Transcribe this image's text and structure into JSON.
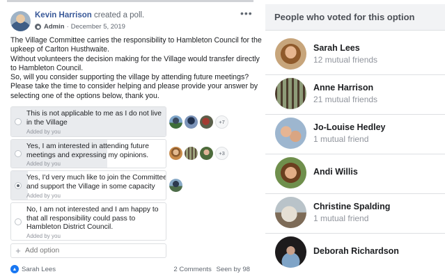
{
  "post": {
    "author": "Kevin Harrison",
    "action": "created a poll.",
    "role": "Admin",
    "date": "December 5, 2019",
    "more": "•••",
    "body_lines": [
      "The Village Committee carries the responsibility to Hambleton Council for the",
      "upkeep of Carlton Husthwaite.",
      "Without volunteers the decision making for the Village would transfer directly",
      "to Hambleton Council.",
      "So, will you consider supporting the village by attending future meetings?",
      "Please take the time to consider helping and please provide your answer by",
      "selecting one of the options below, thank you."
    ],
    "options": [
      {
        "lines": [
          "This is not applicable to me as I do not live",
          "in the Village"
        ],
        "added_by": "Added by you",
        "selected": false,
        "vote_fraction": 1.0,
        "more_voters": "+7"
      },
      {
        "lines": [
          "Yes, I am interested in attending future",
          "meetings and expressing my opinions."
        ],
        "added_by": "Added by you",
        "selected": false,
        "vote_fraction": 0.62,
        "more_voters": "+3"
      },
      {
        "lines": [
          "Yes, I'd very much like to join the Committee",
          "and support the Village in some capacity"
        ],
        "added_by": "Added by you",
        "selected": true,
        "vote_fraction": 0.11,
        "more_voters": ""
      },
      {
        "lines": [
          "No, I am not interested and I am happy to",
          "that all responsibility could pass to",
          "Hambleton District Council."
        ],
        "added_by": "Added by you",
        "selected": false,
        "vote_fraction": 0,
        "more_voters": ""
      }
    ],
    "add_option_placeholder": "Add option",
    "add_option_icon": "+",
    "like_name": "Sarah Lees",
    "comments": "2 Comments",
    "seen": "Seen by 98"
  },
  "voters_panel": {
    "title": "People who voted for this option",
    "people": [
      {
        "name": "Sarah Lees",
        "mutual": "12 mutual friends"
      },
      {
        "name": "Anne Harrison",
        "mutual": "21 mutual friends"
      },
      {
        "name": "Jo-Louise Hedley",
        "mutual": "1 mutual friend"
      },
      {
        "name": "Andi Willis",
        "mutual": ""
      },
      {
        "name": "Christine Spalding",
        "mutual": "1 mutual friend"
      },
      {
        "name": "Deborah Richardson",
        "mutual": ""
      }
    ]
  },
  "colors": {
    "link": "#385898",
    "vote_fill": "#e9ebee",
    "like_blue": "#1877f2",
    "panel_header": "#f2f3f5"
  }
}
